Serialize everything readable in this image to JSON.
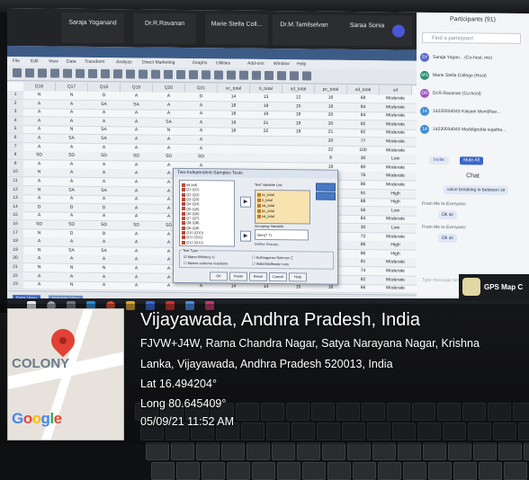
{
  "meeting": {
    "tiles": [
      "Saraja Yoganand",
      "Dr.R.Ravanan",
      "Marie Stella Coll...",
      "Dr.M.Tamilselvan",
      "Saraa Sonia"
    ]
  },
  "spss": {
    "menu": [
      "File",
      "Edit",
      "View",
      "Data",
      "Transform",
      "Analyze",
      "Direct Marketing",
      "Graphs",
      "Utilities",
      "Add-ons",
      "Window",
      "Help"
    ],
    "columns": [
      "Q16",
      "Q17",
      "Q18",
      "Q19",
      "Q20",
      "Q21",
      "sc_total",
      "ti_total",
      "sd_total",
      "pc_total",
      "sd_total",
      "sd"
    ],
    "rows": [
      [
        "1",
        "N",
        "N",
        "D",
        "A",
        "A",
        "D",
        "14",
        "13",
        "12",
        "16",
        "68",
        "Moderate"
      ],
      [
        "2",
        "A",
        "A",
        "SA",
        "SA",
        "A",
        "A",
        "18",
        "19",
        "15",
        "19",
        "84",
        "Moderate"
      ],
      [
        "3",
        "A",
        "A",
        "A",
        "A",
        "A",
        "A",
        "18",
        "19",
        "18",
        "20",
        "84",
        "Moderate"
      ],
      [
        "4",
        "A",
        "A",
        "A",
        "A",
        "SA",
        "A",
        "19",
        "21",
        "18",
        "20",
        "82",
        "Moderate"
      ],
      [
        "5",
        "A",
        "N",
        "SA",
        "A",
        "N",
        "A",
        "18",
        "22",
        "18",
        "21",
        "82",
        "Moderate"
      ],
      [
        "6",
        "A",
        "SA",
        "SA",
        "A",
        "A",
        "A",
        "",
        "",
        "",
        "20",
        "77",
        "Moderate"
      ],
      [
        "7",
        "A",
        "A",
        "A",
        "A",
        "A",
        "A",
        "",
        "",
        "",
        "22",
        "100",
        "Moderate"
      ],
      [
        "8",
        "SD",
        "SD",
        "SD",
        "SD",
        "SD",
        "SD",
        "",
        "",
        "",
        "8",
        "30",
        "Low"
      ],
      [
        "9",
        "A",
        "A",
        "A",
        "A",
        "A",
        "A",
        "",
        "",
        "",
        "19",
        "80",
        "Moderate"
      ],
      [
        "10",
        "N",
        "A",
        "A",
        "A",
        "A",
        "A",
        "",
        "",
        "",
        "19",
        "76",
        "Moderate"
      ],
      [
        "11",
        "A",
        "A",
        "A",
        "A",
        "A",
        "A",
        "",
        "",
        "",
        "18",
        "86",
        "Moderate"
      ],
      [
        "12",
        "N",
        "SA",
        "SA",
        "A",
        "A",
        "A",
        "",
        "",
        "",
        "20",
        "91",
        "High"
      ],
      [
        "13",
        "A",
        "A",
        "A",
        "A",
        "A",
        "A",
        "",
        "",
        "",
        "20",
        "88",
        "High"
      ],
      [
        "14",
        "D",
        "D",
        "D",
        "A",
        "A",
        "A",
        "",
        "",
        "",
        "12",
        "56",
        "Low"
      ],
      [
        "15",
        "A",
        "A",
        "A",
        "A",
        "A",
        "A",
        "",
        "",
        "",
        "19",
        "84",
        "Moderate"
      ],
      [
        "16",
        "SD",
        "SD",
        "SD",
        "SD",
        "SD",
        "SD",
        "",
        "",
        "",
        "9",
        "30",
        "Low"
      ],
      [
        "17",
        "N",
        "D",
        "D",
        "A",
        "A",
        "A",
        "",
        "",
        "",
        "16",
        "72",
        "Moderate"
      ],
      [
        "18",
        "A",
        "A",
        "A",
        "A",
        "A",
        "A",
        "",
        "",
        "",
        "20",
        "86",
        "High"
      ],
      [
        "19",
        "N",
        "SA",
        "SA",
        "A",
        "A",
        "A",
        "22",
        "21",
        "20",
        "21",
        "86",
        "High"
      ],
      [
        "20",
        "A",
        "A",
        "A",
        "A",
        "A",
        "A",
        "19",
        "21",
        "20",
        "22",
        "81",
        "Moderate"
      ],
      [
        "21",
        "N",
        "N",
        "N",
        "A",
        "A",
        "A",
        "13",
        "16",
        "17",
        "17",
        "74",
        "Moderate"
      ],
      [
        "22",
        "A",
        "A",
        "A",
        "A",
        "A",
        "A",
        "20",
        "19",
        "20",
        "21",
        "82",
        "Moderate"
      ],
      [
        "23",
        "A",
        "N",
        "A",
        "A",
        "A",
        "A",
        "14",
        "14",
        "15",
        "16",
        "66",
        "Moderate"
      ]
    ],
    "view_tabs": [
      "Data View",
      "Variable View"
    ]
  },
  "dialog": {
    "title": "Two-Independent-Samples Tests",
    "left_items": [
      "sd (sd)",
      "Q1 (Q1)",
      "Q2 (Q2)",
      "Q3 (Q3)",
      "Q4 (Q4)",
      "Q5 (Q5)",
      "Q6 (Q6)",
      "Q7 (Q7)",
      "Q8 (Q8)",
      "Q9 (Q9)",
      "Q10 (Q10)",
      "Q11 (Q11)",
      "Q12 (Q12)"
    ],
    "right_label": "Test Variable List:",
    "right_items": [
      "sc_total",
      "ti_total",
      "sd_total",
      "pc_total",
      "sd_total"
    ],
    "grouping_label": "Grouping Variable:",
    "grouping_value": "Gen(? ?)",
    "define_groups": "Define Groups...",
    "test_type_label": "Test Type",
    "test_options": [
      "Mann-Whitney U",
      "Kolmogorov-Smirnov Z",
      "Moses extreme reactions",
      "Wald-Wolfowitz runs"
    ],
    "buttons": [
      "OK",
      "Paste",
      "Reset",
      "Cancel",
      "Help"
    ]
  },
  "panel": {
    "header": "Participants (91)",
    "search_placeholder": "Find a participant",
    "participants": [
      {
        "initials": "SY",
        "name": "Saraja Yogan... (Co-host, me)",
        "color": "#5b6ac9"
      },
      {
        "initials": "MS",
        "name": "Marie Stella College (Host)",
        "color": "#2f8c73"
      },
      {
        "initials": "DR",
        "name": "Dr.R.Ravanan (Co-host)",
        "color": "#9d5bbf"
      },
      {
        "initials": "14",
        "name": "14220034043 Kalyani Moni(Rav...",
        "color": "#3e8fd2"
      },
      {
        "initials": "14",
        "name": "14220034043 Maddigedda sujatha...",
        "color": "#3e8fd2"
      }
    ],
    "invite_label": "Invite",
    "mute_label": "Mute All",
    "chat_title": "Chat",
    "chat_messages": [
      "voice breaking in between sir",
      "From Me to Everyone:",
      "Ok sir",
      "From Me to Everyone:",
      "Ok sir"
    ],
    "chat_input": "Type message here..."
  },
  "taskbar": {
    "gps_label": "GPS Map C"
  },
  "overlay": {
    "map_label": "COLONY",
    "google_logo": "Google",
    "city": "Vijayawada, Andhra Pradesh, India",
    "address_line1": "FJVW+J4W, Rama Chandra Nagar, Satya Narayana Nagar, Krishna",
    "address_line2": "Lanka, Vijayawada, Andhra Pradesh 520013, India",
    "lat": "Lat 16.494204°",
    "long": "Long 80.645409°",
    "datetime": "05/09/21 11:52 AM"
  },
  "colors": {
    "pin": "#e14235",
    "accent_blue": "#3a66c8"
  }
}
